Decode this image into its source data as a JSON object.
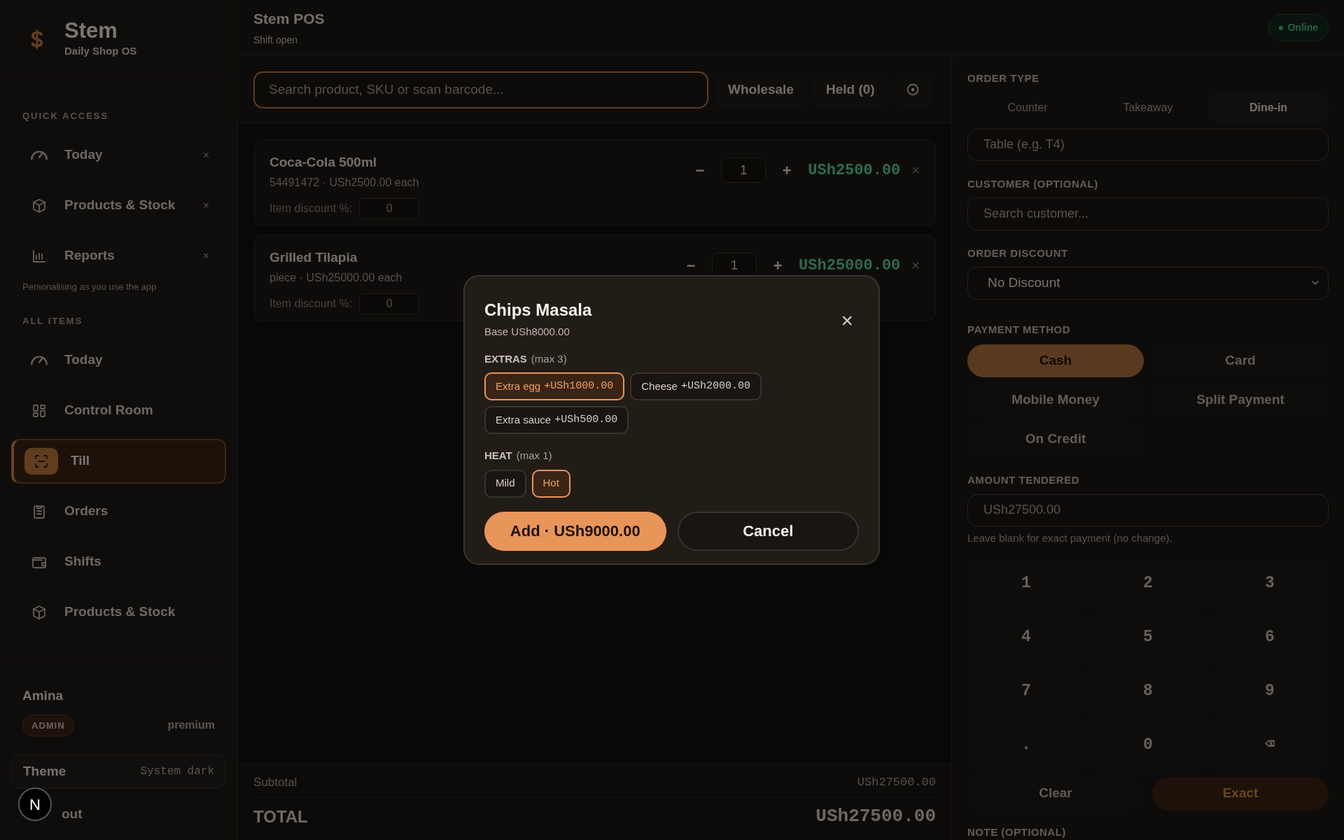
{
  "brand": {
    "name": "Stem",
    "subtitle": "Daily Shop OS"
  },
  "sidebar": {
    "sections": [
      {
        "title": "QUICK ACCESS",
        "note": "Personalising as you use the app",
        "items": [
          {
            "label": "Today",
            "selected": false,
            "remove": "×"
          },
          {
            "label": "Products & Stock",
            "selected": false,
            "remove": "×"
          },
          {
            "label": "Reports",
            "selected": false,
            "remove": "×"
          }
        ]
      },
      {
        "title": "ALL ITEMS",
        "items": [
          {
            "label": "Today",
            "selected": false
          },
          {
            "label": "Control Room",
            "selected": false
          },
          {
            "label": "Till",
            "selected": true
          },
          {
            "label": "Orders",
            "selected": false
          },
          {
            "label": "Shifts",
            "selected": false
          },
          {
            "label": "Products & Stock",
            "selected": false
          }
        ]
      }
    ]
  },
  "user": {
    "name": "Amina",
    "role": "ADMIN",
    "plan": "premium"
  },
  "theme": {
    "label": "Theme",
    "value": "System dark"
  },
  "logout": "out",
  "dev_badge": "N",
  "header": {
    "title": "Stem POS",
    "subtitle": "Shift open",
    "status": "Online"
  },
  "toolbar": {
    "search_placeholder": "Search product, SKU or scan barcode...",
    "buttons": [
      "Wholesale",
      "Held (0)"
    ]
  },
  "cart": [
    {
      "name": "Coca-Cola 500ml",
      "meta": "54491472 · USh2500.00 each",
      "minus": "−",
      "qty": "1",
      "plus": "+",
      "line_total": "USh2500.00",
      "remove": "×",
      "discount_label": "Item discount %:",
      "discount": "0"
    },
    {
      "name": "Grilled Tilapia",
      "meta": "piece · USh25000.00 each",
      "minus": "−",
      "qty": "1",
      "plus": "+",
      "line_total": "USh25000.00",
      "remove": "×",
      "discount_label": "Item discount %:",
      "discount": "0"
    }
  ],
  "totals": {
    "subtotal_label": "Subtotal",
    "subtotal": "USh27500.00",
    "total_label": "TOTAL",
    "total": "USh27500.00"
  },
  "modal": {
    "title": "Chips Masala",
    "base": "Base USh8000.00",
    "close": "×",
    "groups": [
      {
        "title": "EXTRAS",
        "hint": "(max 3)",
        "options": [
          {
            "label": "Extra egg",
            "price": "+USh1000.00",
            "selected": true
          },
          {
            "label": "Cheese",
            "price": "+USh2000.00",
            "selected": false
          },
          {
            "label": "Extra sauce",
            "price": "+USh500.00",
            "selected": false
          }
        ]
      },
      {
        "title": "HEAT",
        "hint": "(max 1)",
        "options": [
          {
            "label": "Mild",
            "selected": false
          },
          {
            "label": "Hot",
            "selected": true
          }
        ]
      }
    ],
    "add": "Add · USh9000.00",
    "cancel": "Cancel"
  },
  "order": {
    "type_label": "ORDER TYPE",
    "types": [
      {
        "label": "Counter",
        "selected": false
      },
      {
        "label": "Takeaway",
        "selected": false
      },
      {
        "label": "Dine-in",
        "selected": true
      }
    ],
    "table_placeholder": "Table (e.g. T4)",
    "customer_label": "CUSTOMER (OPTIONAL)",
    "customer_placeholder": "Search customer...",
    "discount_label": "ORDER DISCOUNT",
    "discount_value": "No Discount",
    "payment_label": "PAYMENT METHOD",
    "payment_methods": [
      {
        "label": "Cash",
        "selected": true
      },
      {
        "label": "Card",
        "selected": false
      },
      {
        "label": "Mobile Money",
        "selected": false
      },
      {
        "label": "Split Payment",
        "selected": false
      },
      {
        "label": "On Credit",
        "selected": false
      }
    ],
    "amount_label": "AMOUNT TENDERED",
    "amount_placeholder": "USh27500.00",
    "amount_hint": "Leave blank for exact payment (no change).",
    "keypad": [
      "1",
      "2",
      "3",
      "4",
      "5",
      "6",
      "7",
      "8",
      "9",
      ".",
      "0",
      "⌫"
    ],
    "clear": "Clear",
    "exact": "Exact",
    "note_label": "NOTE (OPTIONAL)"
  }
}
